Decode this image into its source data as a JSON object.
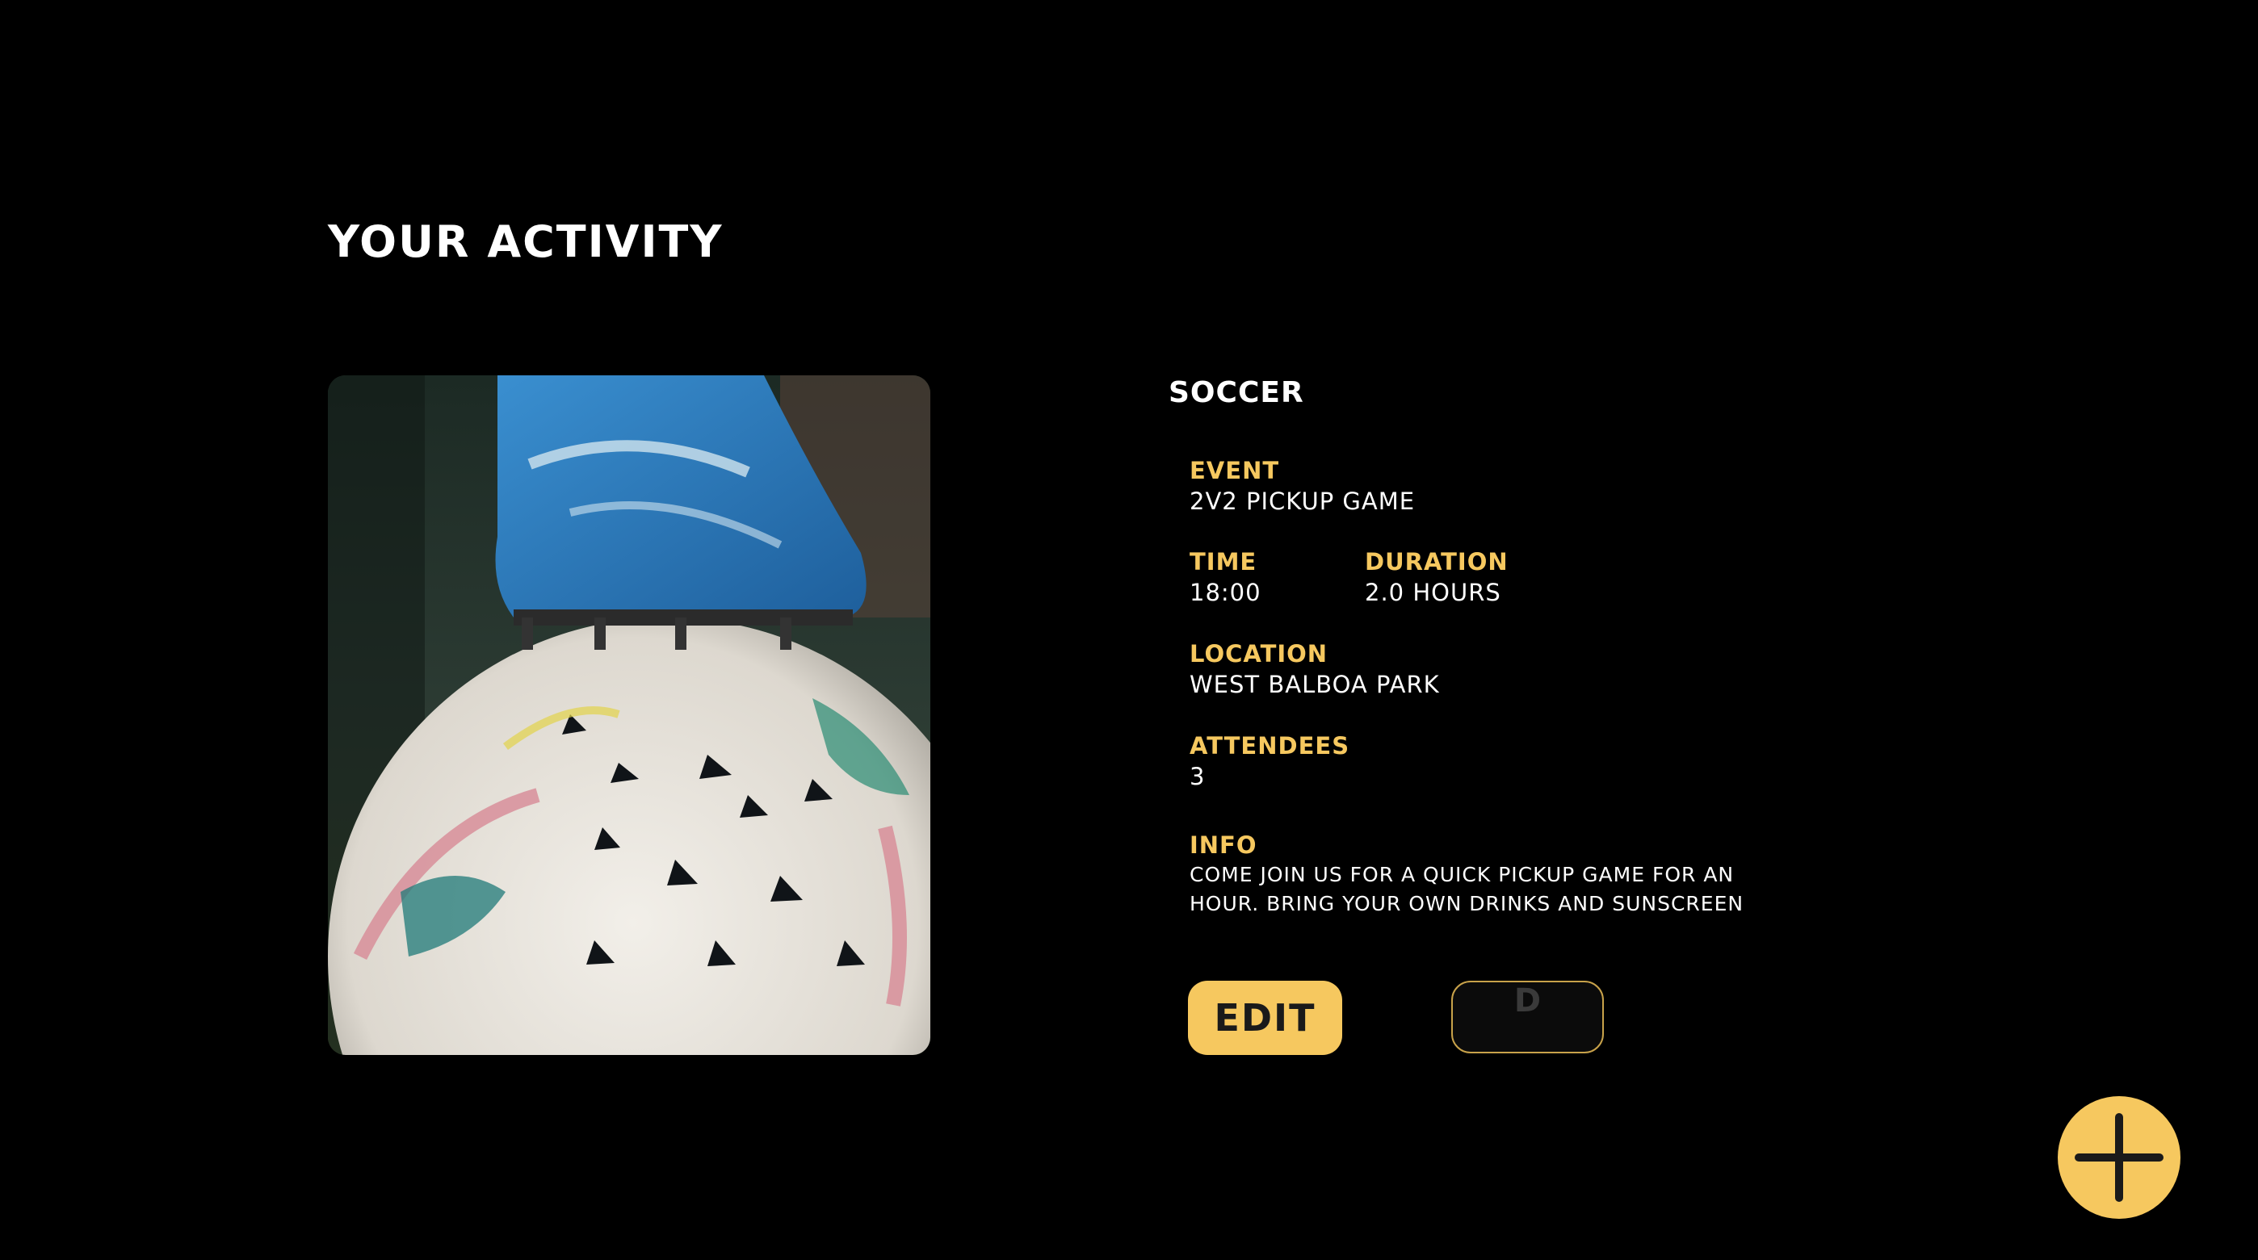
{
  "header": {
    "title": "YOUR ACTIVITY"
  },
  "activity": {
    "sport": "SOCCER",
    "event_label": "EVENT",
    "event_value": "2V2 PICKUP GAME",
    "time_label": "TIME",
    "time_value": "18:00",
    "duration_label": "DURATION",
    "duration_value": "2.0 HOURS",
    "location_label": "LOCATION",
    "location_value": "WEST BALBOA PARK",
    "attendees_label": "ATTENDEES",
    "attendees_value": "3",
    "info_label": "INFO",
    "info_value": "COME JOIN US FOR A QUICK PICKUP GAME FOR AN HOUR. BRING YOUR OWN DRINKS AND SUNSCREEN"
  },
  "actions": {
    "edit_label": "EDIT",
    "delete_label": "D"
  },
  "fab": {
    "icon": "plus-icon"
  },
  "colors": {
    "background": "#000000",
    "accent": "#f6c85f",
    "text": "#ffffff"
  }
}
